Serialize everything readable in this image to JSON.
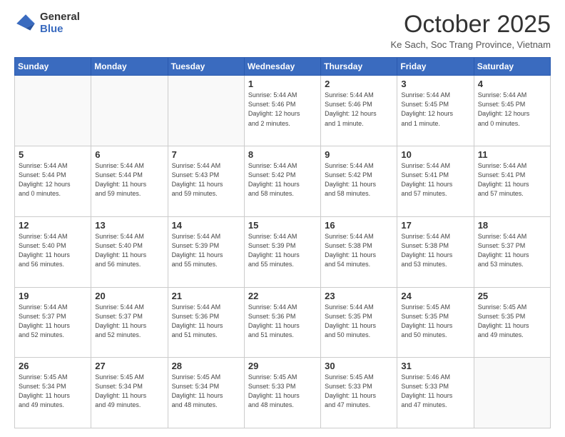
{
  "logo": {
    "general": "General",
    "blue": "Blue"
  },
  "title": "October 2025",
  "subtitle": "Ke Sach, Soc Trang Province, Vietnam",
  "days_of_week": [
    "Sunday",
    "Monday",
    "Tuesday",
    "Wednesday",
    "Thursday",
    "Friday",
    "Saturday"
  ],
  "weeks": [
    [
      {
        "day": "",
        "info": ""
      },
      {
        "day": "",
        "info": ""
      },
      {
        "day": "",
        "info": ""
      },
      {
        "day": "1",
        "info": "Sunrise: 5:44 AM\nSunset: 5:46 PM\nDaylight: 12 hours\nand 2 minutes."
      },
      {
        "day": "2",
        "info": "Sunrise: 5:44 AM\nSunset: 5:46 PM\nDaylight: 12 hours\nand 1 minute."
      },
      {
        "day": "3",
        "info": "Sunrise: 5:44 AM\nSunset: 5:45 PM\nDaylight: 12 hours\nand 1 minute."
      },
      {
        "day": "4",
        "info": "Sunrise: 5:44 AM\nSunset: 5:45 PM\nDaylight: 12 hours\nand 0 minutes."
      }
    ],
    [
      {
        "day": "5",
        "info": "Sunrise: 5:44 AM\nSunset: 5:44 PM\nDaylight: 12 hours\nand 0 minutes."
      },
      {
        "day": "6",
        "info": "Sunrise: 5:44 AM\nSunset: 5:44 PM\nDaylight: 11 hours\nand 59 minutes."
      },
      {
        "day": "7",
        "info": "Sunrise: 5:44 AM\nSunset: 5:43 PM\nDaylight: 11 hours\nand 59 minutes."
      },
      {
        "day": "8",
        "info": "Sunrise: 5:44 AM\nSunset: 5:42 PM\nDaylight: 11 hours\nand 58 minutes."
      },
      {
        "day": "9",
        "info": "Sunrise: 5:44 AM\nSunset: 5:42 PM\nDaylight: 11 hours\nand 58 minutes."
      },
      {
        "day": "10",
        "info": "Sunrise: 5:44 AM\nSunset: 5:41 PM\nDaylight: 11 hours\nand 57 minutes."
      },
      {
        "day": "11",
        "info": "Sunrise: 5:44 AM\nSunset: 5:41 PM\nDaylight: 11 hours\nand 57 minutes."
      }
    ],
    [
      {
        "day": "12",
        "info": "Sunrise: 5:44 AM\nSunset: 5:40 PM\nDaylight: 11 hours\nand 56 minutes."
      },
      {
        "day": "13",
        "info": "Sunrise: 5:44 AM\nSunset: 5:40 PM\nDaylight: 11 hours\nand 56 minutes."
      },
      {
        "day": "14",
        "info": "Sunrise: 5:44 AM\nSunset: 5:39 PM\nDaylight: 11 hours\nand 55 minutes."
      },
      {
        "day": "15",
        "info": "Sunrise: 5:44 AM\nSunset: 5:39 PM\nDaylight: 11 hours\nand 55 minutes."
      },
      {
        "day": "16",
        "info": "Sunrise: 5:44 AM\nSunset: 5:38 PM\nDaylight: 11 hours\nand 54 minutes."
      },
      {
        "day": "17",
        "info": "Sunrise: 5:44 AM\nSunset: 5:38 PM\nDaylight: 11 hours\nand 53 minutes."
      },
      {
        "day": "18",
        "info": "Sunrise: 5:44 AM\nSunset: 5:37 PM\nDaylight: 11 hours\nand 53 minutes."
      }
    ],
    [
      {
        "day": "19",
        "info": "Sunrise: 5:44 AM\nSunset: 5:37 PM\nDaylight: 11 hours\nand 52 minutes."
      },
      {
        "day": "20",
        "info": "Sunrise: 5:44 AM\nSunset: 5:37 PM\nDaylight: 11 hours\nand 52 minutes."
      },
      {
        "day": "21",
        "info": "Sunrise: 5:44 AM\nSunset: 5:36 PM\nDaylight: 11 hours\nand 51 minutes."
      },
      {
        "day": "22",
        "info": "Sunrise: 5:44 AM\nSunset: 5:36 PM\nDaylight: 11 hours\nand 51 minutes."
      },
      {
        "day": "23",
        "info": "Sunrise: 5:44 AM\nSunset: 5:35 PM\nDaylight: 11 hours\nand 50 minutes."
      },
      {
        "day": "24",
        "info": "Sunrise: 5:45 AM\nSunset: 5:35 PM\nDaylight: 11 hours\nand 50 minutes."
      },
      {
        "day": "25",
        "info": "Sunrise: 5:45 AM\nSunset: 5:35 PM\nDaylight: 11 hours\nand 49 minutes."
      }
    ],
    [
      {
        "day": "26",
        "info": "Sunrise: 5:45 AM\nSunset: 5:34 PM\nDaylight: 11 hours\nand 49 minutes."
      },
      {
        "day": "27",
        "info": "Sunrise: 5:45 AM\nSunset: 5:34 PM\nDaylight: 11 hours\nand 49 minutes."
      },
      {
        "day": "28",
        "info": "Sunrise: 5:45 AM\nSunset: 5:34 PM\nDaylight: 11 hours\nand 48 minutes."
      },
      {
        "day": "29",
        "info": "Sunrise: 5:45 AM\nSunset: 5:33 PM\nDaylight: 11 hours\nand 48 minutes."
      },
      {
        "day": "30",
        "info": "Sunrise: 5:45 AM\nSunset: 5:33 PM\nDaylight: 11 hours\nand 47 minutes."
      },
      {
        "day": "31",
        "info": "Sunrise: 5:46 AM\nSunset: 5:33 PM\nDaylight: 11 hours\nand 47 minutes."
      },
      {
        "day": "",
        "info": ""
      }
    ]
  ]
}
